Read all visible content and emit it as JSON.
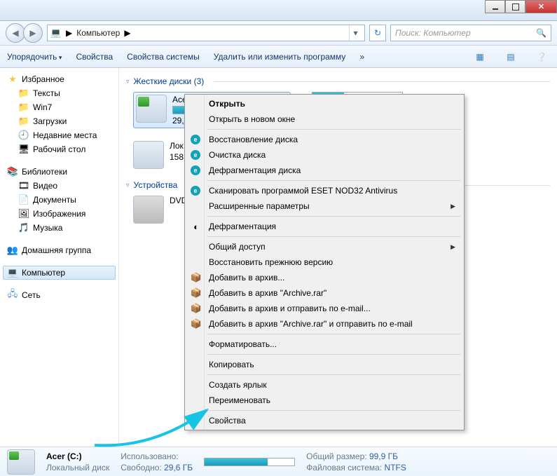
{
  "address": {
    "root_tip": "▶",
    "crumb": "Компьютер",
    "crumb_tip": "▶",
    "refresh_glyph": "↻"
  },
  "search": {
    "placeholder": "Поиск: Компьютер",
    "icon": "🔍"
  },
  "toolbar": {
    "organize": "Упорядочить",
    "properties": "Свойства",
    "sys_props": "Свойства системы",
    "uninstall": "Удалить или изменить программу",
    "overflow": "»"
  },
  "tree": {
    "favorites": "Избранное",
    "fav_items": [
      "Тексты",
      "Win7",
      "Загрузки",
      "Недавние места",
      "Рабочий стол"
    ],
    "libraries": "Библиотеки",
    "lib_items": [
      "Видео",
      "Документы",
      "Изображения",
      "Музыка"
    ],
    "homegroup": "Домашняя группа",
    "computer": "Компьютер",
    "network": "Сеть"
  },
  "cats": {
    "hdd": "Жесткие диски (3)",
    "removable": "Устройства"
  },
  "drives": {
    "c": {
      "name": "Ace",
      "sub": "29,6"
    },
    "d": {
      "name": "Лок",
      "sub": "158"
    },
    "dvd": {
      "name": "DVD"
    }
  },
  "status": {
    "name": "Acer (C:)",
    "type": "Локальный диск",
    "used_lbl": "Использовано:",
    "free_lbl": "Свободно:",
    "free_val": "29,6 ГБ",
    "total_lbl": "Общий размер:",
    "total_val": "99,9 ГБ",
    "fs_lbl": "Файловая система:",
    "fs_val": "NTFS"
  },
  "ctx": {
    "open": "Открыть",
    "open_new": "Открыть в новом окне",
    "restore": "Восстановление диска",
    "cleanup": "Очистка диска",
    "defrag_disk": "Дефрагментация диска",
    "scan_eset": "Сканировать программой ESET NOD32 Antivirus",
    "adv_opts": "Расширенные параметры",
    "defrag": "Дефрагментация",
    "sharing": "Общий доступ",
    "restore_prev": "Восстановить прежнюю версию",
    "archive_add": "Добавить в архив...",
    "archive_add_rar": "Добавить в архив \"Archive.rar\"",
    "archive_email": "Добавить в архив и отправить по e-mail...",
    "archive_rar_email": "Добавить в архив \"Archive.rar\" и отправить по e-mail",
    "format": "Форматировать...",
    "copy": "Копировать",
    "shortcut": "Создать ярлык",
    "rename": "Переименовать",
    "props": "Свойства"
  }
}
